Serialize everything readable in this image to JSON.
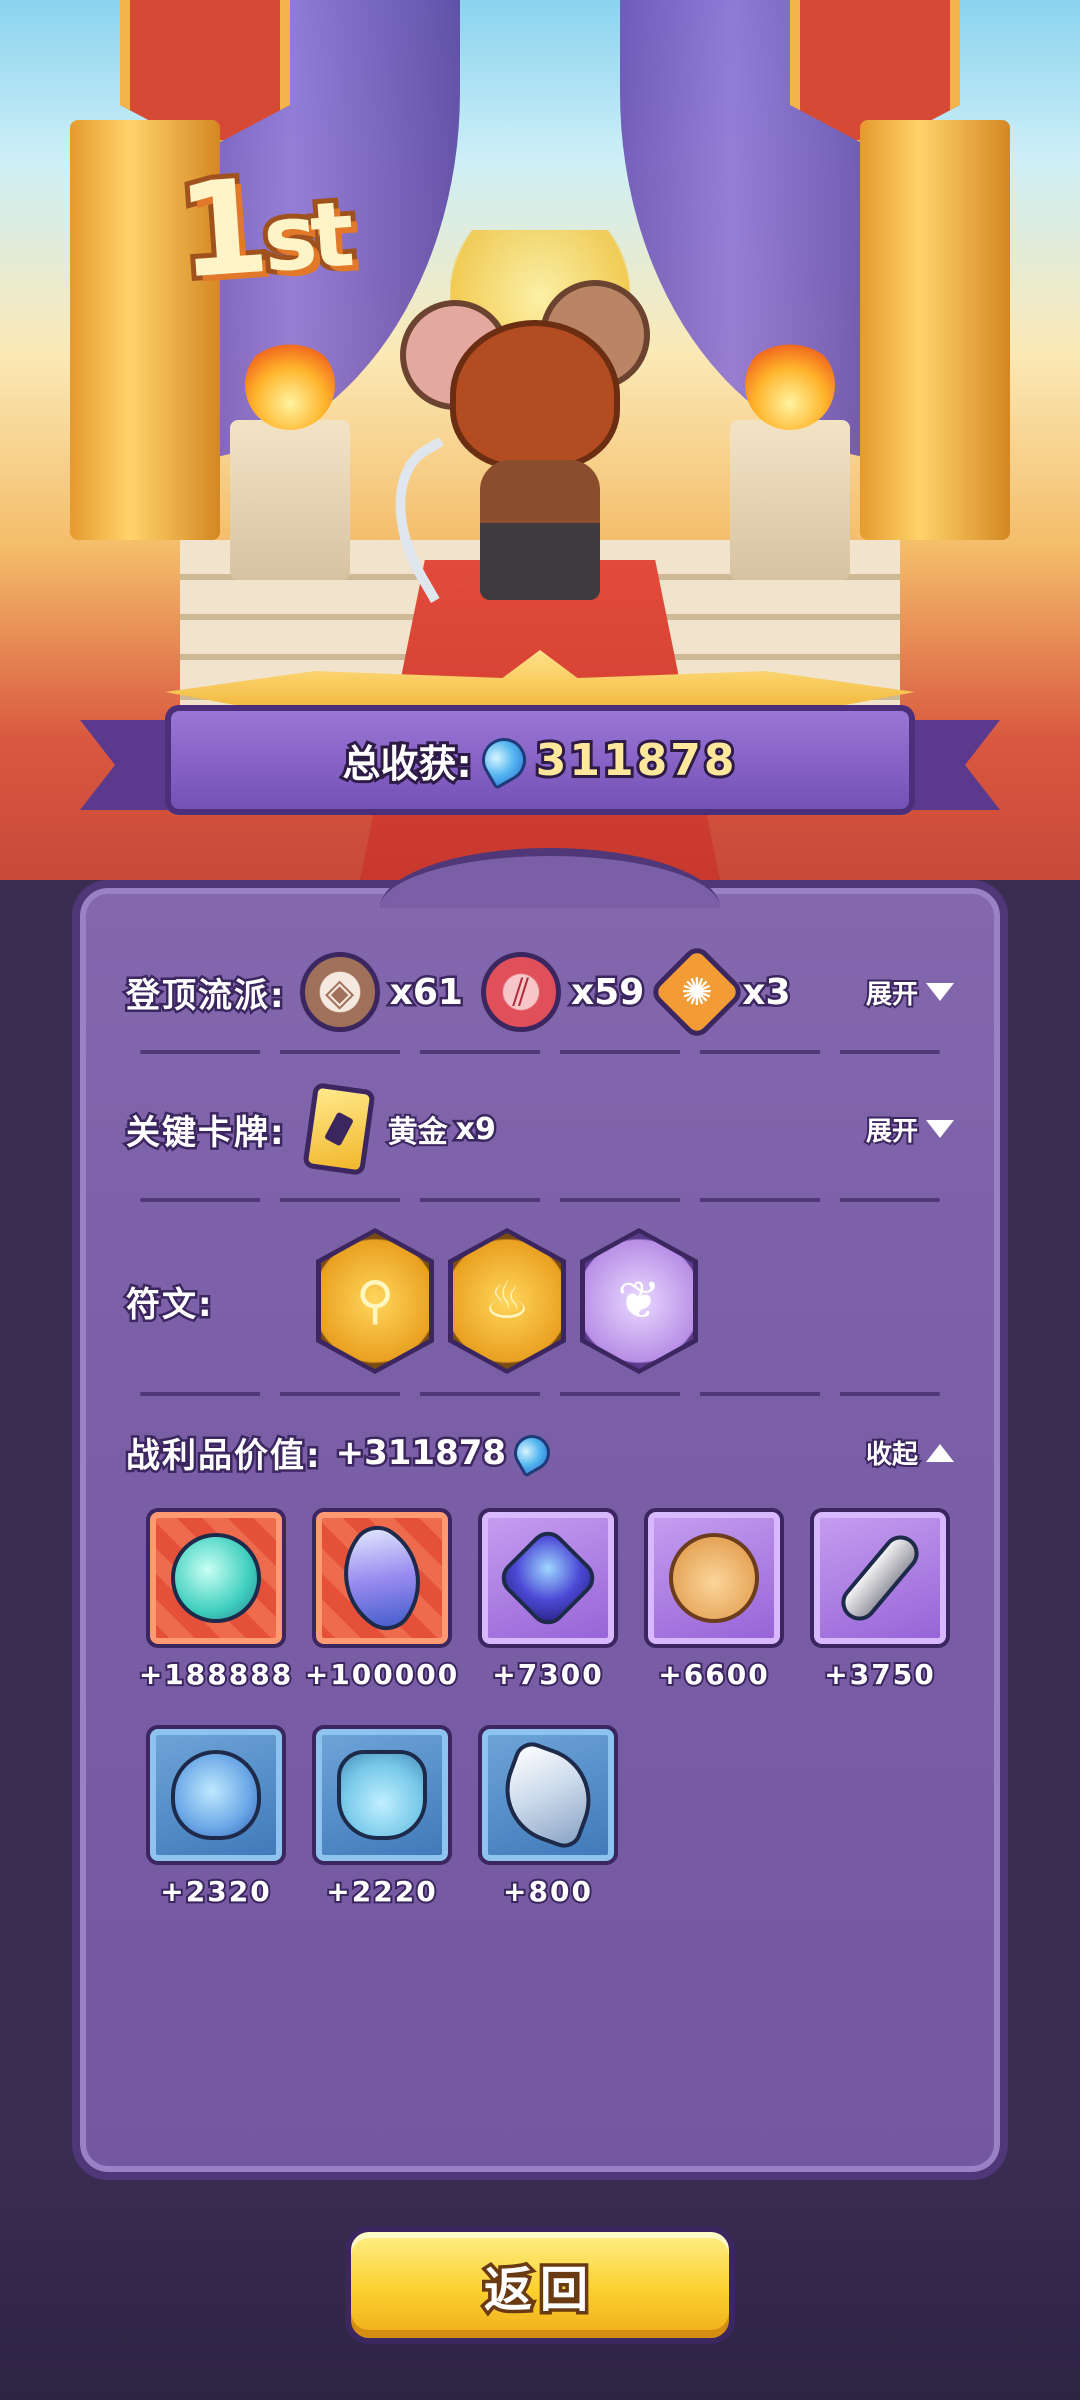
{
  "hero": {
    "rank_number": "1",
    "rank_suffix": "st"
  },
  "total": {
    "label": "总收获:",
    "value": "311878",
    "currency_icon": "blue-gem-icon"
  },
  "summit_style": {
    "label": "登顶流派:",
    "entries": [
      {
        "icon": "shield-badge-icon",
        "count": "x61"
      },
      {
        "icon": "claw-badge-icon",
        "count": "x59"
      },
      {
        "icon": "spiral-badge-icon",
        "count": "x3"
      }
    ],
    "toggle_label": "展开"
  },
  "key_cards": {
    "label": "关键卡牌:",
    "card_icon": "gold-card-icon",
    "card_name": "黄金",
    "card_count": "x9",
    "toggle_label": "展开"
  },
  "runes": {
    "label": "符文:",
    "items": [
      {
        "icon": "gold-stairs-rune-icon",
        "tier": "gold"
      },
      {
        "icon": "gold-fountain-rune-icon",
        "tier": "gold"
      },
      {
        "icon": "purple-leaf-rune-icon",
        "tier": "purple"
      }
    ]
  },
  "loot": {
    "label": "战利品价值:",
    "value": "+311878",
    "currency_icon": "blue-gem-icon",
    "toggle_label": "收起",
    "items": [
      {
        "icon": "frog-orb-icon",
        "rarity": "red",
        "value": "+188888"
      },
      {
        "icon": "crystal-shard-icon",
        "rarity": "red",
        "value": "+100000"
      },
      {
        "icon": "sapphire-gem-icon",
        "rarity": "purple",
        "value": "+7300"
      },
      {
        "icon": "teddy-bear-icon",
        "rarity": "purple",
        "value": "+6600"
      },
      {
        "icon": "silver-key-icon",
        "rarity": "purple",
        "value": "+3750"
      },
      {
        "icon": "pufferfish-icon",
        "rarity": "blue",
        "value": "+2320"
      },
      {
        "icon": "potion-bottle-icon",
        "rarity": "blue",
        "value": "+2220"
      },
      {
        "icon": "white-crystal-icon",
        "rarity": "blue",
        "value": "+800"
      }
    ]
  },
  "footer": {
    "back_label": "返回"
  },
  "colors": {
    "panel": "#7a5ea6",
    "panel_border": "#4f3778",
    "accent_gold": "#fbd02e",
    "rarity_red": "#e4503a",
    "rarity_purple": "#9562d6",
    "rarity_blue": "#3e78b8"
  }
}
